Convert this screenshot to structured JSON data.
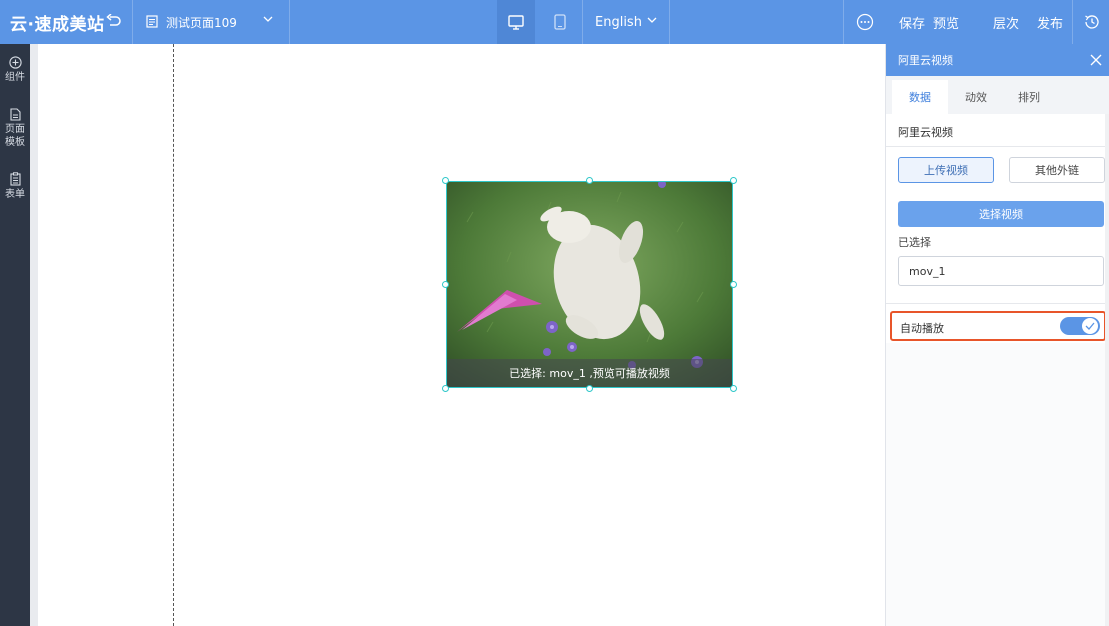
{
  "app": {
    "logo": "云·速成美站"
  },
  "toolbar": {
    "page_name": "测试页面109",
    "language": "English",
    "actions": {
      "save": "保存",
      "preview": "预览",
      "layers": "层次",
      "publish": "发布"
    }
  },
  "sidebar": {
    "items": [
      {
        "label": "组件",
        "icon": "plus-circle-icon"
      },
      {
        "label": "页面\n模板",
        "icon": "page-icon"
      },
      {
        "label": "表单",
        "icon": "clipboard-icon"
      }
    ]
  },
  "video": {
    "caption": "已选择: mov_1 ,预览可播放视频"
  },
  "panel": {
    "title": "阿里云视频",
    "tabs": [
      "数据",
      "动效",
      "排列"
    ],
    "active_tab": "数据",
    "section_title": "阿里云视频",
    "upload_button": "上传视频",
    "external_button": "其他外链",
    "choose_button": "选择视频",
    "selected_label": "已选择",
    "selected_value": "mov_1",
    "autoplay_label": "自动播放",
    "autoplay_on": true
  },
  "colors": {
    "topbar": "#5b95e5",
    "sidebar": "#2d3645",
    "selection": "#2ec7c9",
    "highlight": "#e8552a"
  }
}
